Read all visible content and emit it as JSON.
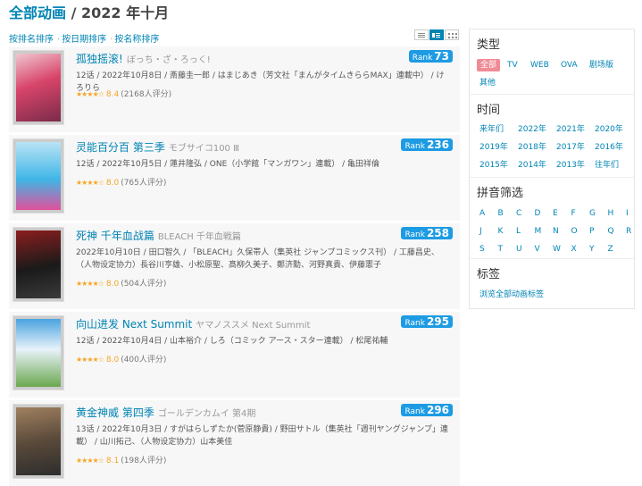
{
  "header": {
    "category": "全部动画",
    "separator": " / ",
    "period": "2022 年十月"
  },
  "sort": {
    "items": [
      "按排名排序",
      "按日期排序",
      "按名称排序"
    ],
    "separator": "·"
  },
  "list": [
    {
      "title_cn": "孤独摇滚!",
      "title_jp": "ぼっち・ざ・ろっく!",
      "rank_label": "Rank",
      "rank": "73",
      "info": "12话 / 2022年10月8日 / 斎藤圭一郎 / はまじあき（芳文社「まんがタイムきららMAX」連載中） / けろりら",
      "stars": "★★★★☆",
      "score": "8.4",
      "count": "(2168人评分)",
      "cover_colors": [
        "#d8446a",
        "#7a2b4a",
        "#f0c7d1"
      ]
    },
    {
      "title_cn": "灵能百分百 第三季",
      "title_jp": "モブサイコ100 Ⅲ",
      "rank_label": "Rank",
      "rank": "236",
      "info": "12话 / 2022年10月5日 / 蓮井隆弘 / ONE（小学館「マンガワン」連載） / 亀田祥倫",
      "stars": "★★★★☆",
      "score": "8.0",
      "count": "(765人评分)",
      "cover_colors": [
        "#3fb6e6",
        "#b9e3f5",
        "#e0509a"
      ]
    },
    {
      "title_cn": "死神 千年血战篇",
      "title_jp": "BLEACH 千年血戦篇",
      "rank_label": "Rank",
      "rank": "258",
      "info": "2022年10月10日 / 田口智久 / 「BLEACH」久保帯人（集英社 ジャンプコミックス刊） / 工藤昌史、（人物设定协力）長谷川亨雄、小松原聖、髙柳久美子、鄭济勳、河野真貴、伊藤憲子",
      "stars": "★★★★☆",
      "score": "8.0",
      "count": "(504人评分)",
      "cover_colors": [
        "#1a1a1a",
        "#8a1e1e",
        "#e8e8e8"
      ]
    },
    {
      "title_cn": "向山进发 Next Summit",
      "title_jp": "ヤマノススメ Next Summit",
      "rank_label": "Rank",
      "rank": "295",
      "info": "12话 / 2022年10月4日 / 山本裕介 / しろ（コミック アース・スター連載） / 松尾祐輔",
      "stars": "★★★★☆",
      "score": "8.0",
      "count": "(400人评分)",
      "cover_colors": [
        "#4aa3e0",
        "#e8f2fa",
        "#6aa84f"
      ]
    },
    {
      "title_cn": "黄金神威 第四季",
      "title_jp": "ゴールデンカムイ 第4期",
      "rank_label": "Rank",
      "rank": "296",
      "info": "13话 / 2022年10月3日 / すがはらしずたか(菅原静貴) / 野田サトル（集英社「週刊ヤングジャンプ」連載） / 山川拓己、（人物设定协力）山本美佳",
      "stars": "★★★★☆",
      "score": "8.1",
      "count": "(198人评分)",
      "cover_colors": [
        "#5a4a3a",
        "#a08060",
        "#2d2d2d"
      ]
    }
  ],
  "sidebar": {
    "type": {
      "title": "类型",
      "items": [
        "全部",
        "TV",
        "WEB",
        "OVA",
        "剧场版",
        "其他"
      ]
    },
    "time": {
      "title": "时间",
      "items": [
        "来年们",
        "2022年",
        "2021年",
        "2020年",
        "2019年",
        "2018年",
        "2017年",
        "2016年",
        "2015年",
        "2014年",
        "2013年",
        "往年们"
      ]
    },
    "pinyin": {
      "title": "拼音筛选",
      "items": [
        "A",
        "B",
        "C",
        "D",
        "E",
        "F",
        "G",
        "H",
        "I",
        "J",
        "K",
        "L",
        "M",
        "N",
        "O",
        "P",
        "Q",
        "R",
        "S",
        "T",
        "U",
        "V",
        "W",
        "X",
        "Y",
        "Z"
      ]
    },
    "tags": {
      "title": "标签",
      "link": "浏览全部动画标签"
    }
  }
}
